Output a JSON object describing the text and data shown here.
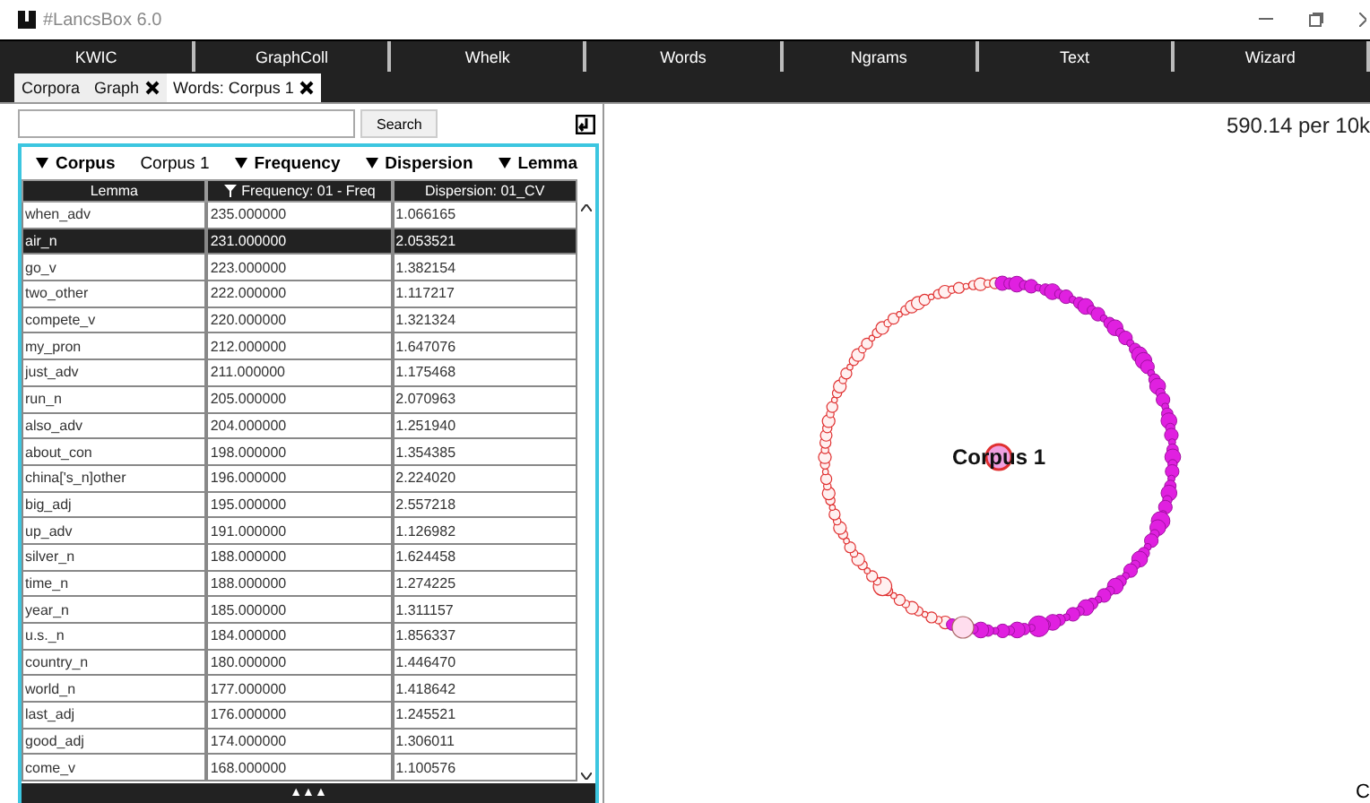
{
  "window": {
    "title": "#LancsBox 6.0"
  },
  "menu": [
    {
      "label": "KWIC"
    },
    {
      "label": "GraphColl"
    },
    {
      "label": "Whelk"
    },
    {
      "label": "Words"
    },
    {
      "label": "Ngrams"
    },
    {
      "label": "Text"
    },
    {
      "label": "Wizard"
    }
  ],
  "tabs": [
    {
      "label": "Corpora",
      "closable": false,
      "selected": false
    },
    {
      "label": "Graph",
      "closable": true,
      "selected": false
    },
    {
      "label": "Words: Corpus 1",
      "closable": true,
      "selected": true
    }
  ],
  "search": {
    "button": "Search"
  },
  "filters": [
    {
      "label": "Corpus",
      "kind": "dropdown"
    },
    {
      "label": "Corpus 1",
      "kind": "value"
    },
    {
      "label": "Frequency",
      "kind": "dropdown"
    },
    {
      "label": "Dispersion",
      "kind": "dropdown"
    },
    {
      "label": "Lemma",
      "kind": "dropdown"
    }
  ],
  "table": {
    "columns": [
      {
        "label": "Lemma",
        "sorted": false
      },
      {
        "label": "Frequency: 01 - Freq",
        "sorted": true
      },
      {
        "label": "Dispersion: 01_CV",
        "sorted": false
      }
    ],
    "rows": [
      {
        "cells": [
          "when_adv",
          "235.000000",
          "1.066165"
        ],
        "selected": false
      },
      {
        "cells": [
          "air_n",
          "231.000000",
          "2.053521"
        ],
        "selected": true
      },
      {
        "cells": [
          "go_v",
          "223.000000",
          "1.382154"
        ],
        "selected": false
      },
      {
        "cells": [
          "two_other",
          "222.000000",
          "1.117217"
        ],
        "selected": false
      },
      {
        "cells": [
          "compete_v",
          "220.000000",
          "1.321324"
        ],
        "selected": false
      },
      {
        "cells": [
          "my_pron",
          "212.000000",
          "1.647076"
        ],
        "selected": false
      },
      {
        "cells": [
          "just_adv",
          "211.000000",
          "1.175468"
        ],
        "selected": false
      },
      {
        "cells": [
          "run_n",
          "205.000000",
          "2.070963"
        ],
        "selected": false
      },
      {
        "cells": [
          "also_adv",
          "204.000000",
          "1.251940"
        ],
        "selected": false
      },
      {
        "cells": [
          "about_con",
          "198.000000",
          "1.354385"
        ],
        "selected": false
      },
      {
        "cells": [
          "china['s_n]other",
          "196.000000",
          "2.224020"
        ],
        "selected": false
      },
      {
        "cells": [
          "big_adj",
          "195.000000",
          "2.557218"
        ],
        "selected": false
      },
      {
        "cells": [
          "up_adv",
          "191.000000",
          "1.126982"
        ],
        "selected": false
      },
      {
        "cells": [
          "silver_n",
          "188.000000",
          "1.624458"
        ],
        "selected": false
      },
      {
        "cells": [
          "time_n",
          "188.000000",
          "1.274225"
        ],
        "selected": false
      },
      {
        "cells": [
          "year_n",
          "185.000000",
          "1.311157"
        ],
        "selected": false
      },
      {
        "cells": [
          "u.s._n",
          "184.000000",
          "1.856337"
        ],
        "selected": false
      },
      {
        "cells": [
          "country_n",
          "180.000000",
          "1.446470"
        ],
        "selected": false
      },
      {
        "cells": [
          "world_n",
          "177.000000",
          "1.418642"
        ],
        "selected": false
      },
      {
        "cells": [
          "last_adj",
          "176.000000",
          "1.245521"
        ],
        "selected": false
      },
      {
        "cells": [
          "good_adj",
          "174.000000",
          "1.306011"
        ],
        "selected": false
      },
      {
        "cells": [
          "come_v",
          "168.000000",
          "1.100576"
        ],
        "selected": false
      }
    ]
  },
  "expand_bar": "▲▲▲",
  "graph": {
    "reading": "590.14 per 10k",
    "node": "Corpus 1",
    "corner": "C"
  }
}
